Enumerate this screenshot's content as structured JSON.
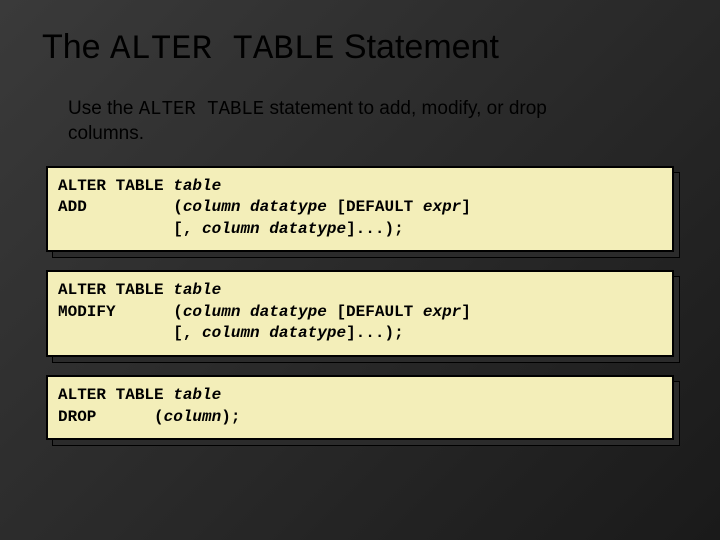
{
  "title": {
    "prefix": "The ",
    "mono": "ALTER TABLE",
    "suffix": " Statement"
  },
  "description": {
    "part1": "Use the ",
    "mono": "ALTER TABLE",
    "part2": " statement to add, modify, or drop columns."
  },
  "codeblocks": {
    "add": {
      "line1_a": "ALTER TABLE ",
      "line1_b": "table",
      "line2_a": "ADD         (",
      "line2_b": "column datatype ",
      "line2_c": "[DEFAULT ",
      "line2_d": "expr",
      "line2_e": "]",
      "line3_a": "            [, ",
      "line3_b": "column datatype",
      "line3_c": "]...);"
    },
    "modify": {
      "line1_a": "ALTER TABLE ",
      "line1_b": "table",
      "line2_a": "MODIFY      (",
      "line2_b": "column datatype ",
      "line2_c": "[DEFAULT ",
      "line2_d": "expr",
      "line2_e": "]",
      "line3_a": "            [, ",
      "line3_b": "column datatype",
      "line3_c": "]...);"
    },
    "drop": {
      "line1_a": "ALTER TABLE ",
      "line1_b": "table",
      "line2_a": "DROP      (",
      "line2_b": "column",
      "line2_c": ");"
    }
  }
}
